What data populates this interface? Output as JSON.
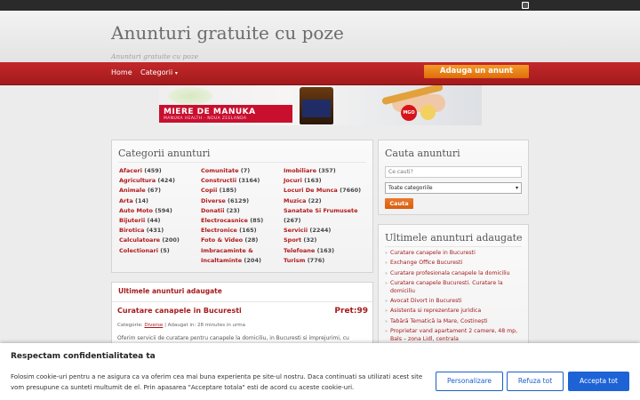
{
  "site": {
    "title": "Anunturi gratuite cu poze",
    "subtitle": "Anunturi gratuite cu poze"
  },
  "nav": {
    "home": "Home",
    "categories": "Categorii",
    "add_button": "Adauga un anunt"
  },
  "banner": {
    "line1": "MIERE DE MANUKA",
    "line2": "MANUKA HEALTH - NOUA ZEELANDA",
    "badge": "MGO"
  },
  "categories": {
    "title": "Categorii anunturi",
    "col1": [
      {
        "name": "Afaceri",
        "count": "(459)"
      },
      {
        "name": "Agricultura",
        "count": "(424)"
      },
      {
        "name": "Animale",
        "count": "(67)"
      },
      {
        "name": "Arta",
        "count": "(14)"
      },
      {
        "name": "Auto Moto",
        "count": "(594)"
      },
      {
        "name": "Bijuterii",
        "count": "(44)"
      },
      {
        "name": "Birotica",
        "count": "(431)"
      },
      {
        "name": "Calculatoare",
        "count": "(200)"
      },
      {
        "name": "Colectionari",
        "count": "(5)"
      }
    ],
    "col2": [
      {
        "name": "Comunitate",
        "count": "(7)"
      },
      {
        "name": "Constructii",
        "count": "(3164)"
      },
      {
        "name": "Copii",
        "count": "(185)"
      },
      {
        "name": "Diverse",
        "count": "(6129)"
      },
      {
        "name": "Donatii",
        "count": "(23)"
      },
      {
        "name": "Electrocasnice",
        "count": "(85)"
      },
      {
        "name": "Electronice",
        "count": "(165)"
      },
      {
        "name": "Foto & Video",
        "count": "(28)"
      },
      {
        "name": "Imbracaminte & Incaltaminte",
        "count": "(204)"
      }
    ],
    "col3": [
      {
        "name": "Imobiliare",
        "count": "(357)"
      },
      {
        "name": "Jocuri",
        "count": "(163)"
      },
      {
        "name": "Locuri De Munca",
        "count": "(7660)"
      },
      {
        "name": "Muzica",
        "count": "(22)"
      },
      {
        "name": "Sanatate Si Frumusete",
        "count": "(267)"
      },
      {
        "name": "Servicii",
        "count": "(2244)"
      },
      {
        "name": "Sport",
        "count": "(32)"
      },
      {
        "name": "Telefoane",
        "count": "(163)"
      },
      {
        "name": "Turism",
        "count": "(776)"
      }
    ]
  },
  "latest_box": {
    "heading": "Ultimele anunturi adaugate",
    "ad": {
      "title": "Curatare canapele in Bucuresti",
      "price": "Pret:99",
      "meta_prefix": "Categorie:",
      "meta_category": "Diverse",
      "meta_suffix": "| Adaugat in: 28 minutes in urma",
      "description": "Oferim servicii de curatare pentru canapele la domiciliu, in Bucuresti si imprejurimi, cu"
    }
  },
  "search": {
    "title": "Cauta anunturi",
    "placeholder": "Ce cauti?",
    "select_value": "Toate categoriile",
    "button": "Cauta"
  },
  "latest_sidebar": {
    "title": "Ultimele anunturi adaugate",
    "items": [
      "Curatare canapele in Bucuresti",
      "Exchange Office Bucuresti",
      "Curatare profesionala canapele la domiciliu",
      "Curatare canapele Bucuresti. Curatare la domiciliu",
      "Avocat Divort in Bucuresti",
      "Asistenta si reprezentare juridica",
      "Tabără Tematică la Mare, Costinești",
      "Proprietar vand apartament 2 camere, 48 mp, Bals – zona Lidl, centrala"
    ]
  },
  "cookie": {
    "title": "Respectam confidentialitatea ta",
    "text": "Folosim cookie-uri pentru a ne asigura ca va oferim cea mai buna experienta pe site-ul nostru. Daca continuati sa utilizati acest site vom presupune ca sunteti multumit de el. Prin apasarea \"Acceptare totala\" esti de acord cu aceste cookie-uri.",
    "btn_customize": "Personalizare",
    "btn_reject": "Refuza tot",
    "btn_accept": "Accepta tot"
  }
}
